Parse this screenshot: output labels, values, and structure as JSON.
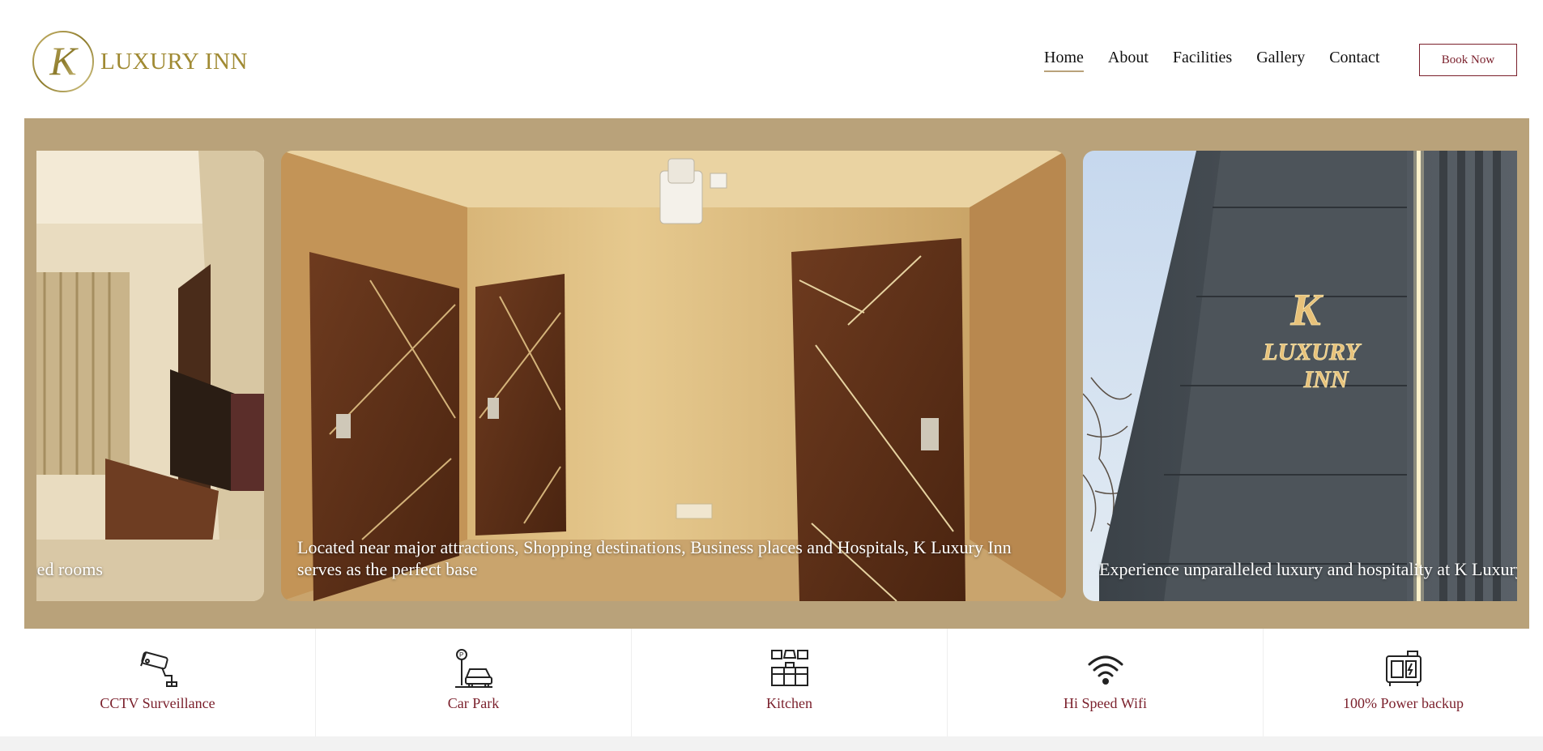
{
  "brand": {
    "name": "LUXURY INN",
    "monogram": "K"
  },
  "nav": {
    "items": [
      "Home",
      "About",
      "Facilities",
      "Gallery",
      "Contact"
    ],
    "active": "Home",
    "book_label": "Book Now"
  },
  "slides": [
    {
      "caption": "signed rooms"
    },
    {
      "caption": "Located near major attractions, Shopping destinations, Business places and Hospitals, K Luxury Inn serves as the perfect base"
    },
    {
      "caption": "Experience unparalleled luxury and hospitality at K Luxury Inn"
    }
  ],
  "signage": {
    "monogram": "K",
    "line1": "LUXURY",
    "line2": "INN"
  },
  "features": [
    {
      "label": "CCTV Surveillance",
      "icon": "cctv-icon"
    },
    {
      "label": "Car Park",
      "icon": "car-park-icon"
    },
    {
      "label": "Kitchen",
      "icon": "kitchen-icon"
    },
    {
      "label": "Hi Speed Wifi",
      "icon": "wifi-icon"
    },
    {
      "label": "100% Power backup",
      "icon": "generator-icon"
    }
  ],
  "colors": {
    "accent": "#7a1f2b",
    "gold": "#a08a33",
    "slider_bg": "#b9a27a"
  }
}
